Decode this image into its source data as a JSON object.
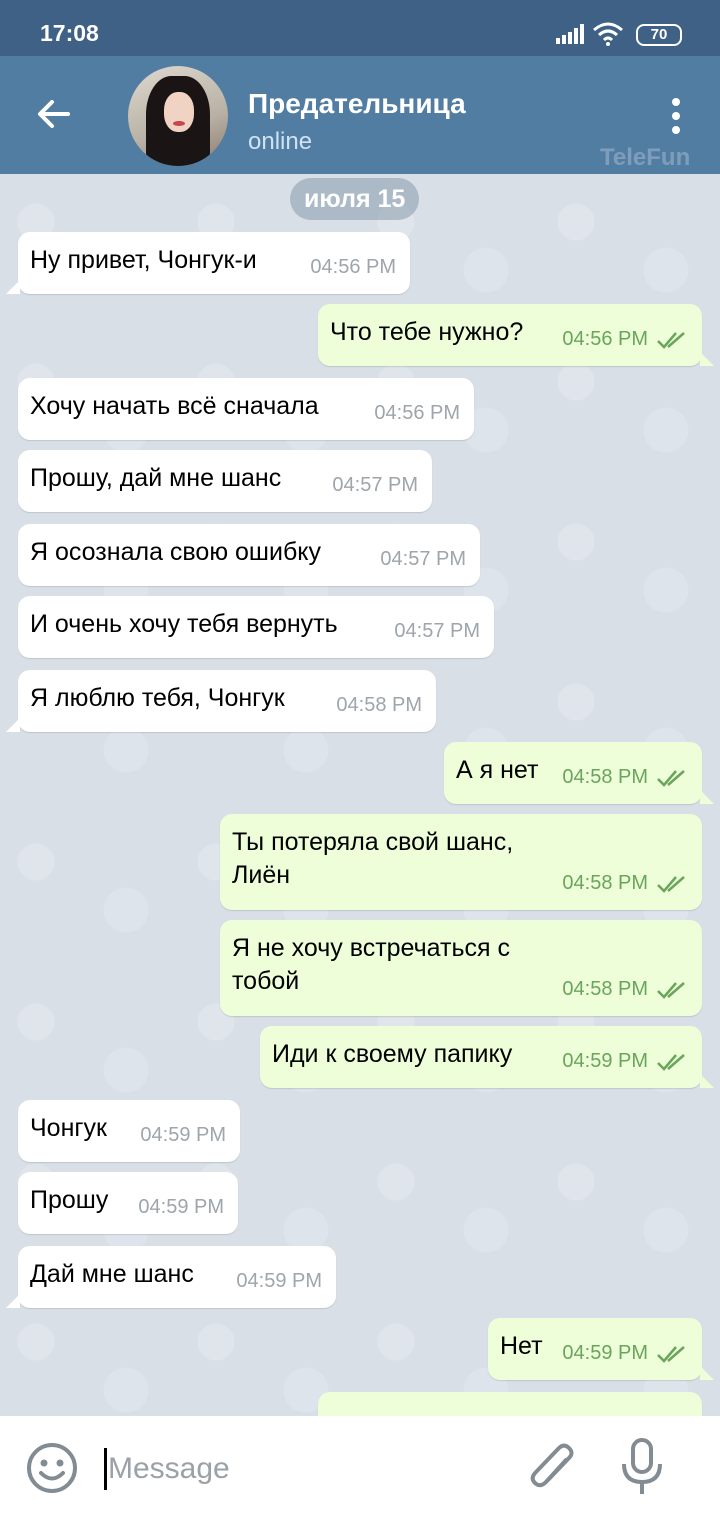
{
  "status_bar": {
    "time": "17:08",
    "battery": "70"
  },
  "header": {
    "name": "Предательница",
    "status": "online",
    "watermark": "TeleFun"
  },
  "chat": {
    "date": "июля 15",
    "messages": [
      {
        "dir": "in",
        "text": "Ну привет, Чонгук-и",
        "time": "04:56 PM"
      },
      {
        "dir": "out",
        "text": "Что тебе нужно?",
        "time": "04:56 PM"
      },
      {
        "dir": "in",
        "text": "Хочу начать всё сначала",
        "time": "04:56 PM"
      },
      {
        "dir": "in",
        "text": "Прошу, дай мне шанс",
        "time": "04:57 PM"
      },
      {
        "dir": "in",
        "text": "Я осознала свою ошибку",
        "time": "04:57 PM"
      },
      {
        "dir": "in",
        "text": "И очень хочу тебя вернуть",
        "time": "04:57 PM"
      },
      {
        "dir": "in",
        "text": "Я люблю тебя, Чонгук",
        "time": "04:58 PM"
      },
      {
        "dir": "out",
        "text": "А я нет",
        "time": "04:58 PM"
      },
      {
        "dir": "out",
        "text": "Ты потеряла свой шанс,\nЛиён",
        "time": "04:58 PM"
      },
      {
        "dir": "out",
        "text": "Я не хочу встречаться с\nтобой",
        "time": "04:58 PM"
      },
      {
        "dir": "out",
        "text": "Иди к своему папику",
        "time": "04:59 PM"
      },
      {
        "dir": "in",
        "text": "Чонгук",
        "time": "04:59 PM"
      },
      {
        "dir": "in",
        "text": "Прошу",
        "time": "04:59 PM"
      },
      {
        "dir": "in",
        "text": "Дай мне шанс",
        "time": "04:59 PM"
      },
      {
        "dir": "out",
        "text": "Нет",
        "time": "04:59 PM"
      }
    ]
  },
  "input": {
    "placeholder": "Message"
  },
  "icons": {
    "back": "arrow-left-icon",
    "menu": "more-vertical-icon",
    "emoji": "emoji-icon",
    "attach": "paperclip-icon",
    "mic": "microphone-icon",
    "read": "double-check-icon"
  },
  "colors": {
    "header": "#527da3",
    "status_bar": "#3f6186",
    "incoming": "#ffffff",
    "outgoing": "#eefed9",
    "read_check": "#69a55b"
  }
}
